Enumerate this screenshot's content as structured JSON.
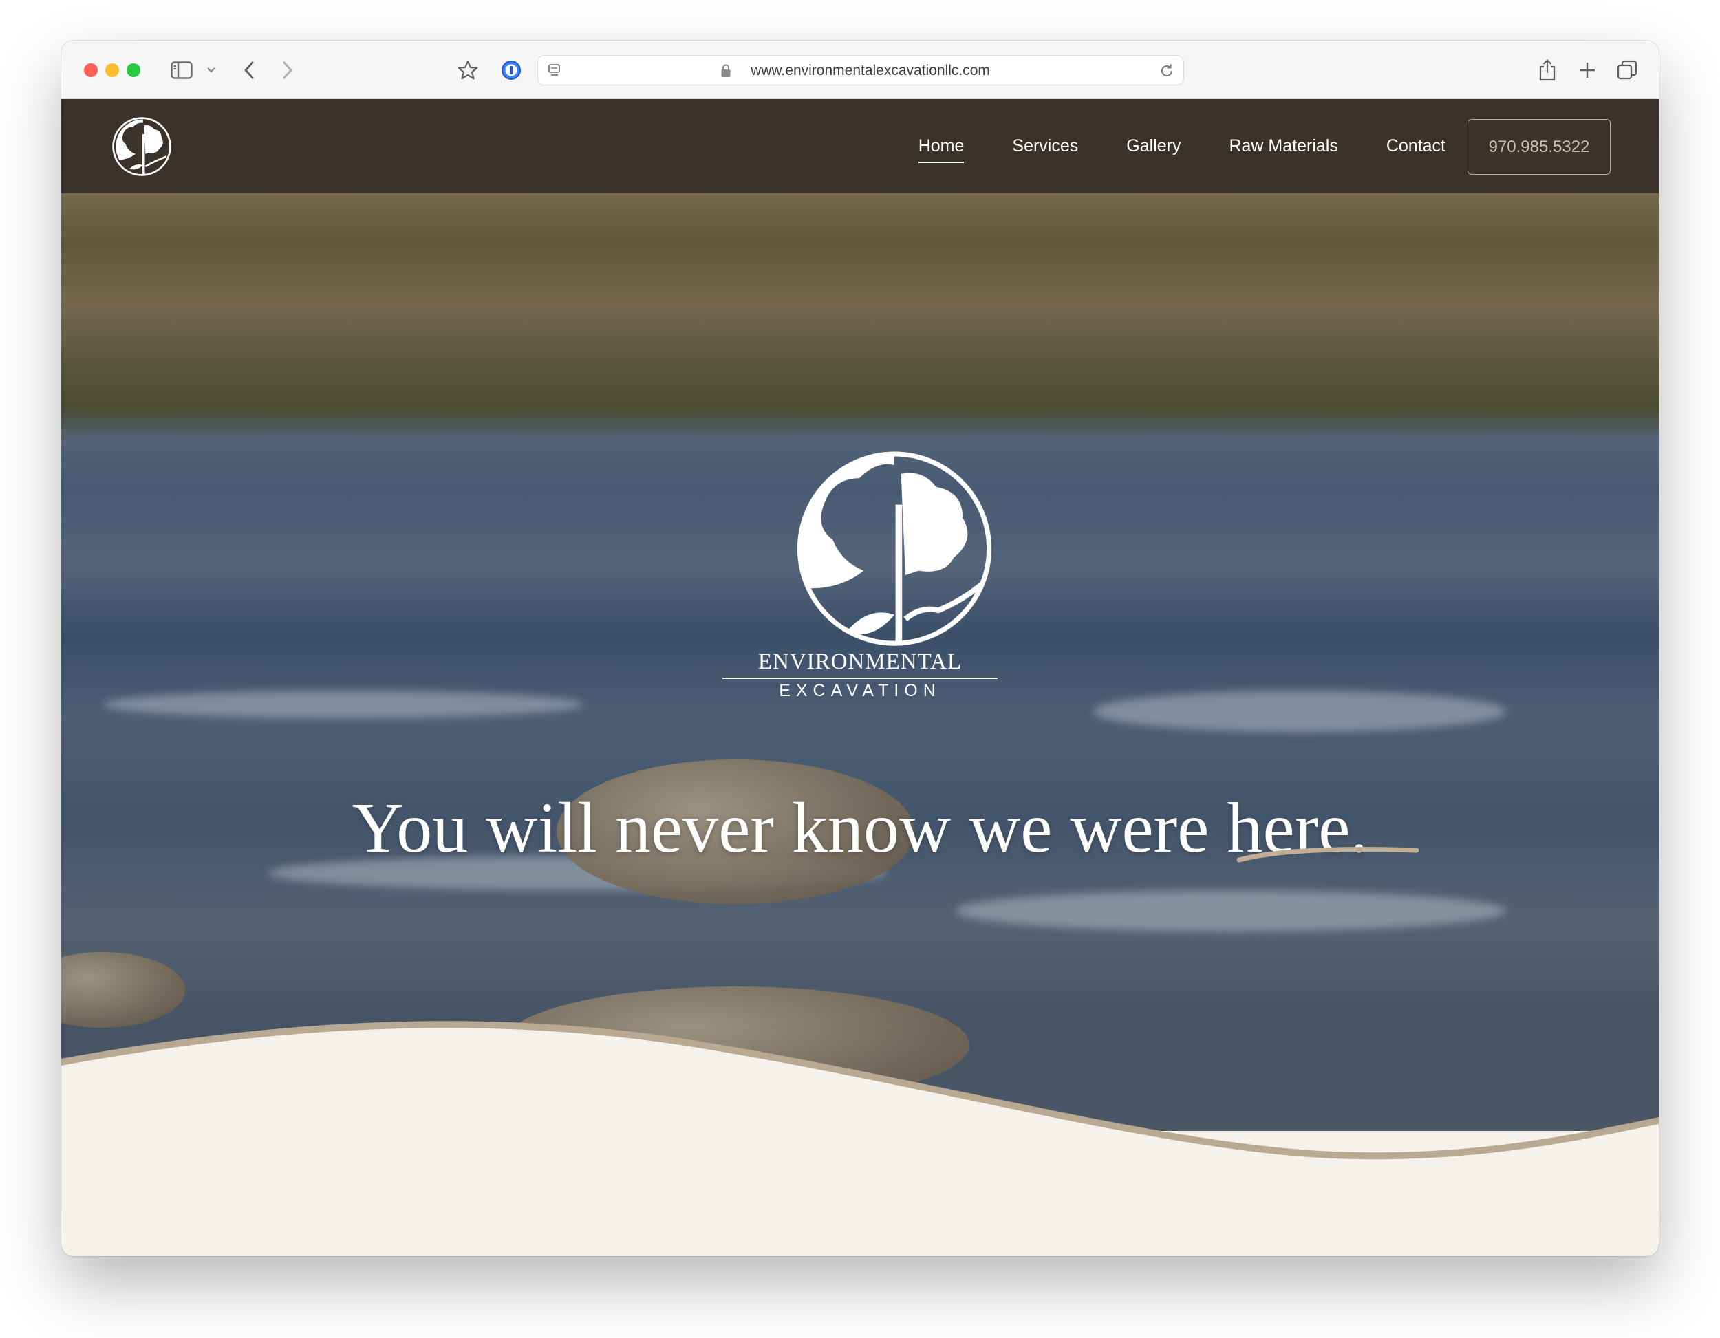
{
  "browser": {
    "url": "www.environmentalexcavationllc.com"
  },
  "nav": {
    "links": [
      {
        "label": "Home"
      },
      {
        "label": "Services"
      },
      {
        "label": "Gallery"
      },
      {
        "label": "Raw Materials"
      },
      {
        "label": "Contact"
      }
    ],
    "phone": "970.985.5322",
    "active": "Home"
  },
  "hero": {
    "brand_line1": "ENVIRONMENTAL",
    "brand_line2": "EXCAVATION",
    "headline": "You will never know we were here."
  },
  "colors": {
    "nav_bg": "#38312b",
    "accent": "#b9a892",
    "page_bg": "#f5f2ec"
  },
  "icons": {
    "toolbar": [
      "sidebar-icon",
      "chevron-down-icon",
      "back-icon",
      "forward-icon",
      "star-icon",
      "password-icon",
      "page-settings-icon",
      "lock-icon",
      "reload-icon",
      "share-icon",
      "new-tab-icon",
      "tabs-icon"
    ],
    "logo": "tree-logo-icon"
  }
}
